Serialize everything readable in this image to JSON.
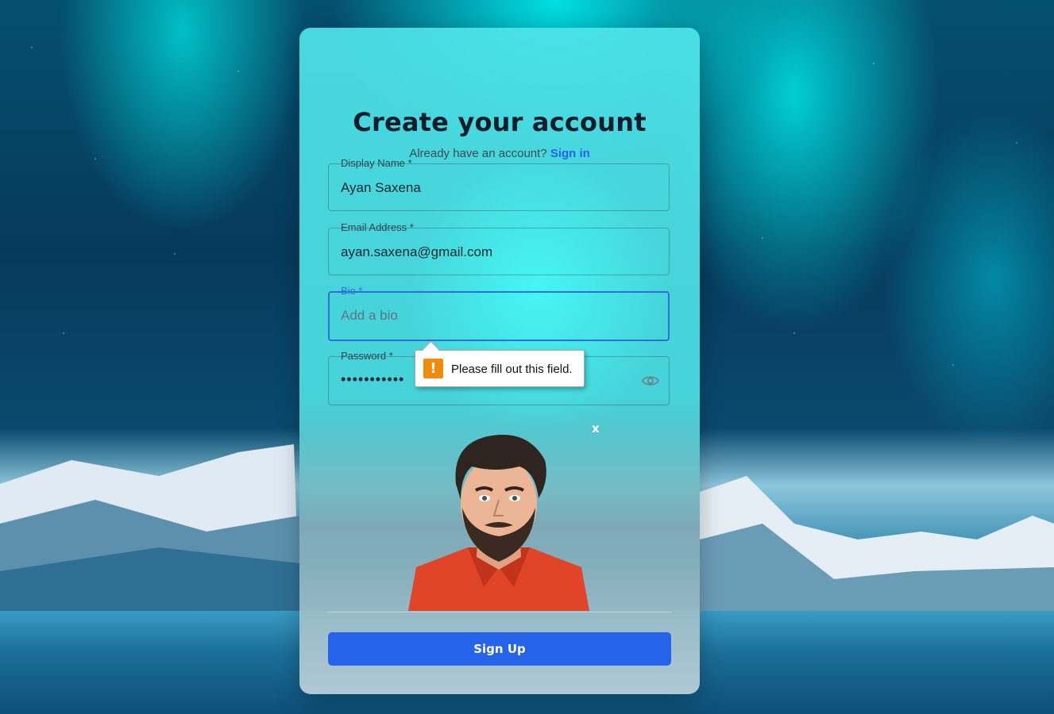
{
  "form": {
    "title": "Create your account",
    "subtitle": "Already have an account?",
    "signin_link": "Sign in",
    "fields": {
      "display_name": {
        "label": "Display Name *",
        "value": "Ayan Saxena"
      },
      "email": {
        "label": "Email Address *",
        "value": "ayan.saxena@gmail.com"
      },
      "bio": {
        "label": "Bio *",
        "placeholder": "Add a bio",
        "value": ""
      },
      "password": {
        "label": "Password *",
        "masked_value": "•••••••••••"
      }
    },
    "validation_message": "Please fill out this field.",
    "avatar_close_label": "x",
    "submit_label": "Sign Up"
  },
  "icons": {
    "password_toggle": "eye-icon",
    "validation": "warning-icon",
    "avatar_remove": "close-icon"
  },
  "colors": {
    "accent": "#2563eb",
    "focus_border": "#2f6fd6",
    "warning": "#f28b0c",
    "title": "#0f1c2b"
  }
}
